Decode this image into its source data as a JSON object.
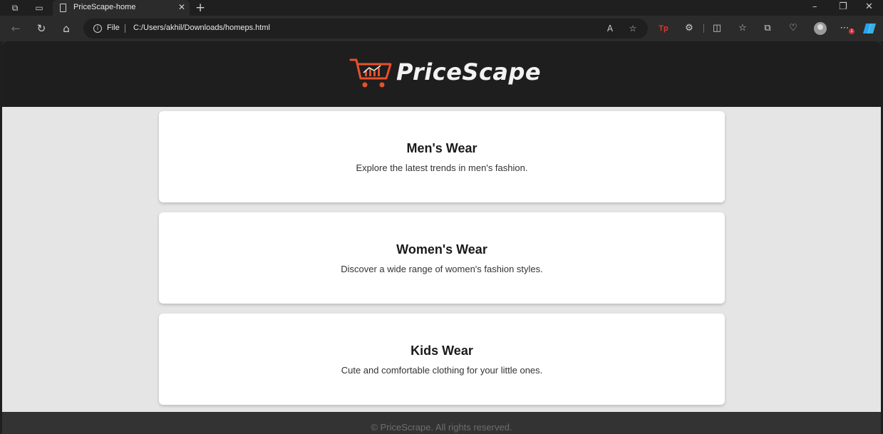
{
  "browser": {
    "tab_title": "PriceScape-home",
    "address_scheme_label": "File",
    "url": "C:/Users/akhil/Downloads/homeps.html",
    "tab_close_glyph": "✕",
    "new_tab_glyph": "+",
    "more_badge": "1",
    "tp_label": "Tp"
  },
  "header": {
    "logo_text": "PriceScape",
    "logo_cart_color": "#e8502a"
  },
  "categories": [
    {
      "title": "Men's Wear",
      "description": "Explore the latest trends in men's fashion."
    },
    {
      "title": "Women's Wear",
      "description": "Discover a wide range of women's fashion styles."
    },
    {
      "title": "Kids Wear",
      "description": "Cute and comfortable clothing for your little ones."
    }
  ],
  "footer": {
    "text": "© PriceScrape. All rights reserved."
  },
  "colors": {
    "header_bg": "#1e1e1e",
    "page_bg": "#e5e5e5",
    "card_bg": "#ffffff",
    "footer_bg": "#333333",
    "footer_text": "#6e6e6e"
  }
}
